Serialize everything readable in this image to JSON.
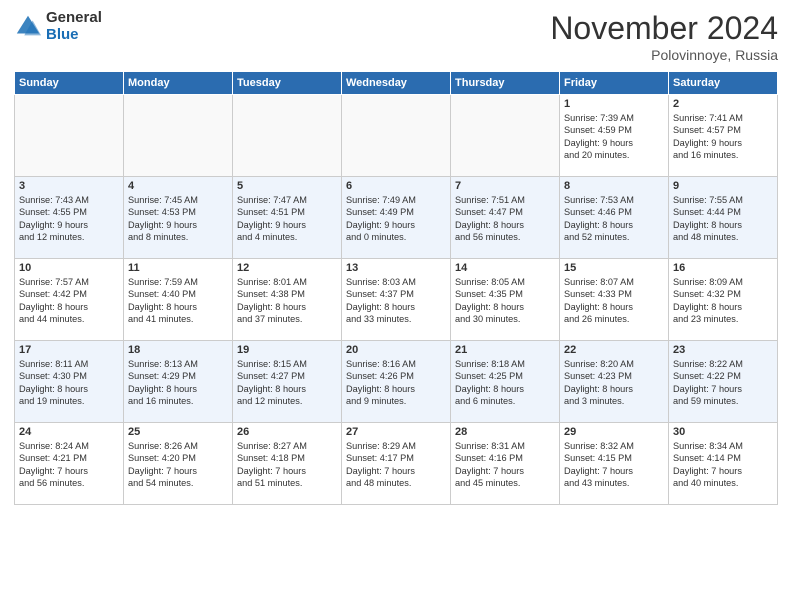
{
  "header": {
    "logo_line1": "General",
    "logo_line2": "Blue",
    "month": "November 2024",
    "location": "Polovinnoye, Russia"
  },
  "weekdays": [
    "Sunday",
    "Monday",
    "Tuesday",
    "Wednesday",
    "Thursday",
    "Friday",
    "Saturday"
  ],
  "weeks": [
    [
      {
        "day": "",
        "info": ""
      },
      {
        "day": "",
        "info": ""
      },
      {
        "day": "",
        "info": ""
      },
      {
        "day": "",
        "info": ""
      },
      {
        "day": "",
        "info": ""
      },
      {
        "day": "1",
        "info": "Sunrise: 7:39 AM\nSunset: 4:59 PM\nDaylight: 9 hours\nand 20 minutes."
      },
      {
        "day": "2",
        "info": "Sunrise: 7:41 AM\nSunset: 4:57 PM\nDaylight: 9 hours\nand 16 minutes."
      }
    ],
    [
      {
        "day": "3",
        "info": "Sunrise: 7:43 AM\nSunset: 4:55 PM\nDaylight: 9 hours\nand 12 minutes."
      },
      {
        "day": "4",
        "info": "Sunrise: 7:45 AM\nSunset: 4:53 PM\nDaylight: 9 hours\nand 8 minutes."
      },
      {
        "day": "5",
        "info": "Sunrise: 7:47 AM\nSunset: 4:51 PM\nDaylight: 9 hours\nand 4 minutes."
      },
      {
        "day": "6",
        "info": "Sunrise: 7:49 AM\nSunset: 4:49 PM\nDaylight: 9 hours\nand 0 minutes."
      },
      {
        "day": "7",
        "info": "Sunrise: 7:51 AM\nSunset: 4:47 PM\nDaylight: 8 hours\nand 56 minutes."
      },
      {
        "day": "8",
        "info": "Sunrise: 7:53 AM\nSunset: 4:46 PM\nDaylight: 8 hours\nand 52 minutes."
      },
      {
        "day": "9",
        "info": "Sunrise: 7:55 AM\nSunset: 4:44 PM\nDaylight: 8 hours\nand 48 minutes."
      }
    ],
    [
      {
        "day": "10",
        "info": "Sunrise: 7:57 AM\nSunset: 4:42 PM\nDaylight: 8 hours\nand 44 minutes."
      },
      {
        "day": "11",
        "info": "Sunrise: 7:59 AM\nSunset: 4:40 PM\nDaylight: 8 hours\nand 41 minutes."
      },
      {
        "day": "12",
        "info": "Sunrise: 8:01 AM\nSunset: 4:38 PM\nDaylight: 8 hours\nand 37 minutes."
      },
      {
        "day": "13",
        "info": "Sunrise: 8:03 AM\nSunset: 4:37 PM\nDaylight: 8 hours\nand 33 minutes."
      },
      {
        "day": "14",
        "info": "Sunrise: 8:05 AM\nSunset: 4:35 PM\nDaylight: 8 hours\nand 30 minutes."
      },
      {
        "day": "15",
        "info": "Sunrise: 8:07 AM\nSunset: 4:33 PM\nDaylight: 8 hours\nand 26 minutes."
      },
      {
        "day": "16",
        "info": "Sunrise: 8:09 AM\nSunset: 4:32 PM\nDaylight: 8 hours\nand 23 minutes."
      }
    ],
    [
      {
        "day": "17",
        "info": "Sunrise: 8:11 AM\nSunset: 4:30 PM\nDaylight: 8 hours\nand 19 minutes."
      },
      {
        "day": "18",
        "info": "Sunrise: 8:13 AM\nSunset: 4:29 PM\nDaylight: 8 hours\nand 16 minutes."
      },
      {
        "day": "19",
        "info": "Sunrise: 8:15 AM\nSunset: 4:27 PM\nDaylight: 8 hours\nand 12 minutes."
      },
      {
        "day": "20",
        "info": "Sunrise: 8:16 AM\nSunset: 4:26 PM\nDaylight: 8 hours\nand 9 minutes."
      },
      {
        "day": "21",
        "info": "Sunrise: 8:18 AM\nSunset: 4:25 PM\nDaylight: 8 hours\nand 6 minutes."
      },
      {
        "day": "22",
        "info": "Sunrise: 8:20 AM\nSunset: 4:23 PM\nDaylight: 8 hours\nand 3 minutes."
      },
      {
        "day": "23",
        "info": "Sunrise: 8:22 AM\nSunset: 4:22 PM\nDaylight: 7 hours\nand 59 minutes."
      }
    ],
    [
      {
        "day": "24",
        "info": "Sunrise: 8:24 AM\nSunset: 4:21 PM\nDaylight: 7 hours\nand 56 minutes."
      },
      {
        "day": "25",
        "info": "Sunrise: 8:26 AM\nSunset: 4:20 PM\nDaylight: 7 hours\nand 54 minutes."
      },
      {
        "day": "26",
        "info": "Sunrise: 8:27 AM\nSunset: 4:18 PM\nDaylight: 7 hours\nand 51 minutes."
      },
      {
        "day": "27",
        "info": "Sunrise: 8:29 AM\nSunset: 4:17 PM\nDaylight: 7 hours\nand 48 minutes."
      },
      {
        "day": "28",
        "info": "Sunrise: 8:31 AM\nSunset: 4:16 PM\nDaylight: 7 hours\nand 45 minutes."
      },
      {
        "day": "29",
        "info": "Sunrise: 8:32 AM\nSunset: 4:15 PM\nDaylight: 7 hours\nand 43 minutes."
      },
      {
        "day": "30",
        "info": "Sunrise: 8:34 AM\nSunset: 4:14 PM\nDaylight: 7 hours\nand 40 minutes."
      }
    ]
  ]
}
